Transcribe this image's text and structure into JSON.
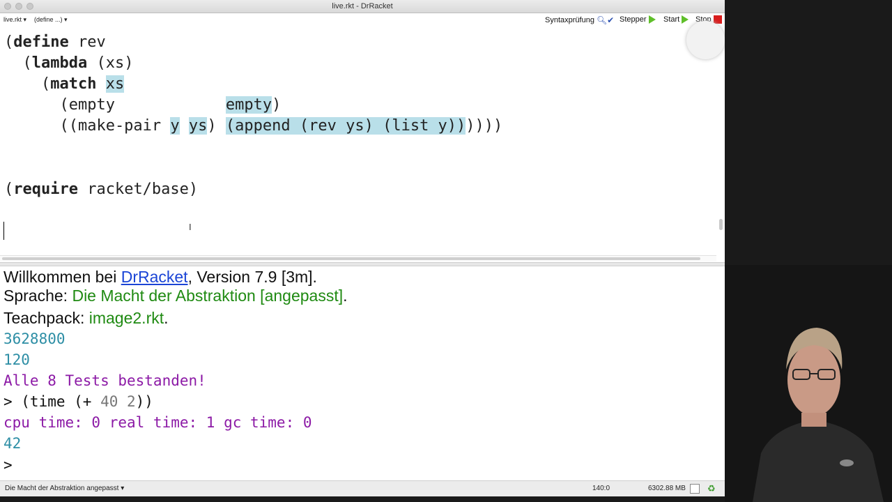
{
  "window": {
    "title": "live.rkt - DrRacket"
  },
  "toolbar": {
    "file_menu": "live.rkt ▾",
    "define_menu": "(define ...) ▾",
    "syntax_check": "Syntaxprüfung",
    "stepper": "Stepper",
    "run": "Start",
    "stop": "Stop"
  },
  "editor": {
    "line1_open": "(",
    "line1_kw": "define",
    "line1_rest": " rev",
    "line2_indent": "  (",
    "line2_kw": "lambda",
    "line2_rest": " (xs)",
    "line3_indent": "    (",
    "line3_kw": "match",
    "line3_sp": " ",
    "line3_hl": "xs",
    "line4_a": "      (empty            ",
    "line4_hl": "empty",
    "line4_b": ")",
    "line5_a": "      ((make-pair ",
    "line5_hl1": "y",
    "line5_sp": " ",
    "line5_hl2": "ys",
    "line5_b": ") ",
    "line5_hl3": "(append (rev ys) (list y))",
    "line5_c": "))))",
    "line6_open": "(",
    "line6_kw": "require",
    "line6_rest": " racket/base)"
  },
  "interactions": {
    "welcome_prefix": "Willkommen bei ",
    "welcome_link": "DrRacket",
    "welcome_suffix": ", Version 7.9 [3m].",
    "lang_prefix": "Sprache: ",
    "lang_value": "Die Macht der Abstraktion [angepasst]",
    "lang_suffix": ".",
    "teachpack_prefix": "Teachpack: ",
    "teachpack_value": "image2.rkt",
    "teachpack_suffix": ".",
    "out1": "3628800",
    "out2": "120",
    "tests": "Alle 8 Tests bestanden!",
    "prompt1_a": "> (time (+ ",
    "prompt1_b": "40 2",
    "prompt1_c": "))",
    "time_out": "cpu time: 0 real time: 1 gc time: 0",
    "out3": "42",
    "prompt2": ">"
  },
  "statusbar": {
    "language": "Die Macht der Abstraktion angepasst ▾",
    "position": "140:0",
    "memory": "6302.88 MB"
  },
  "colors": {
    "highlight": "#b9dfe9",
    "link": "#1b45d6",
    "green": "#1f8a12",
    "teal": "#2d8ea5",
    "purple": "#8c1aa6"
  }
}
